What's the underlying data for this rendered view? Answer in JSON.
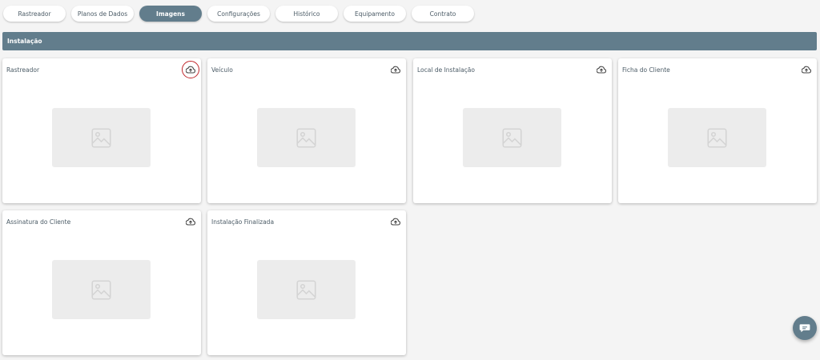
{
  "tabs": [
    {
      "label": "Rastreador",
      "active": false
    },
    {
      "label": "Planos de Dados",
      "active": false
    },
    {
      "label": "Imagens",
      "active": true
    },
    {
      "label": "Configurações",
      "active": false
    },
    {
      "label": "Histórico",
      "active": false
    },
    {
      "label": "Equipamento",
      "active": false
    },
    {
      "label": "Contrato",
      "active": false
    }
  ],
  "section": {
    "title": "Instalação"
  },
  "cards": [
    {
      "title": "Rastreador",
      "upload_icon": "cloud-upload-icon",
      "placeholder_icon": "image-icon"
    },
    {
      "title": "Veículo",
      "upload_icon": "cloud-upload-icon",
      "placeholder_icon": "image-icon"
    },
    {
      "title": "Local de Instalação",
      "upload_icon": "cloud-upload-icon",
      "placeholder_icon": "image-icon"
    },
    {
      "title": "Ficha do Cliente",
      "upload_icon": "cloud-upload-icon",
      "placeholder_icon": "image-icon"
    },
    {
      "title": "Assinatura do Cliente",
      "upload_icon": "cloud-upload-icon",
      "placeholder_icon": "image-icon"
    },
    {
      "title": "Instalação Finalizada",
      "upload_icon": "cloud-upload-icon",
      "placeholder_icon": "image-icon"
    }
  ],
  "chat_button": {
    "icon": "chat-icon"
  },
  "colors": {
    "accent": "#627d8c",
    "highlight": "#c0262b",
    "background": "#f4f4f4"
  }
}
